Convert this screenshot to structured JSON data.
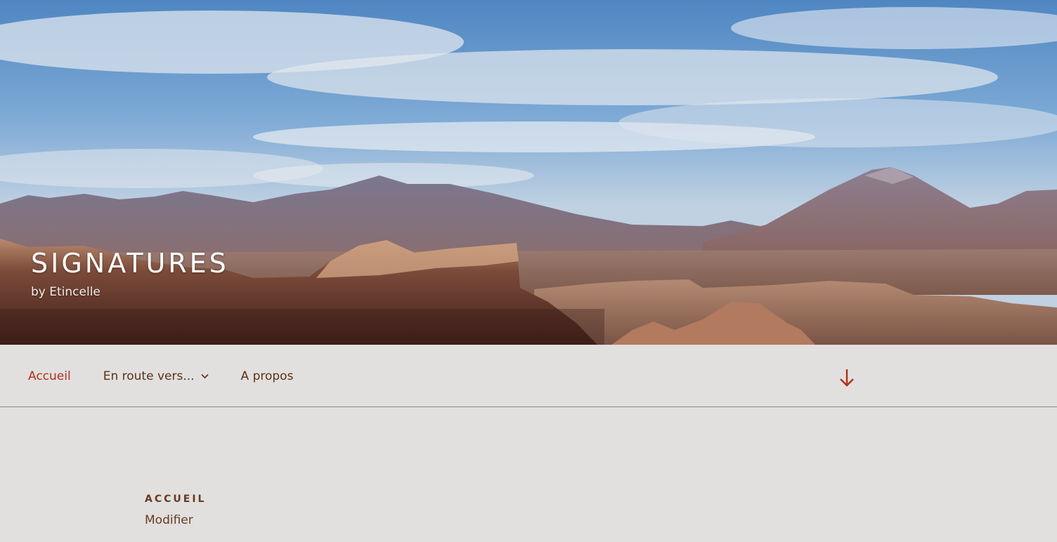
{
  "header": {
    "site_title": "SIGNATURES",
    "tagline": "by Etincelle",
    "image_description": "desert canyon landscape with volcano and blue cloudy sky"
  },
  "nav": {
    "items": [
      {
        "label": "Accueil",
        "current": true,
        "has_submenu": false
      },
      {
        "label": "En route vers...",
        "current": false,
        "has_submenu": true
      },
      {
        "label": "A propos",
        "current": false,
        "has_submenu": false
      }
    ],
    "scroll_icon": "arrow-down-icon"
  },
  "content": {
    "page_label": "ACCUEIL",
    "edit_link": "Modifier"
  },
  "colors": {
    "background": "#e1e0de",
    "accent": "#b0301a",
    "text_brown": "#5a3118"
  }
}
